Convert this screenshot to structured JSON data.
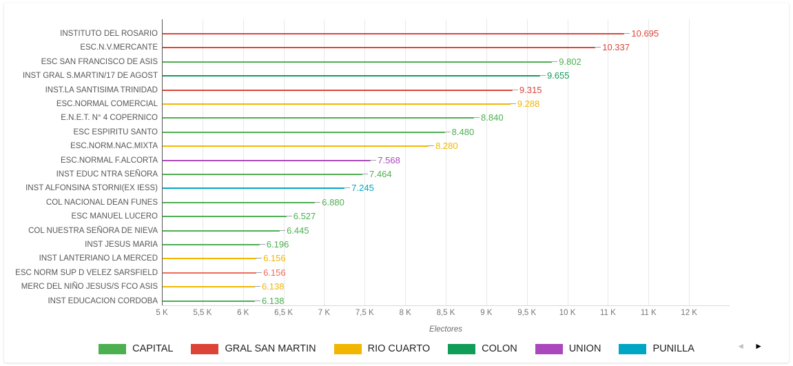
{
  "chart_data": {
    "type": "bar",
    "orientation": "horizontal",
    "title": "",
    "xlabel": "Electores",
    "ylabel": "",
    "xlim": [
      5000,
      12000
    ],
    "grid": true,
    "legend_position": "bottom",
    "x_tick_labels": [
      "5 K",
      "5,5 K",
      "6 K",
      "6,5 K",
      "7 K",
      "7,5 K",
      "8 K",
      "8,5 K",
      "9 K",
      "9,5 K",
      "10 K",
      "11 K",
      "11 K",
      "12 K"
    ],
    "x_tick_values": [
      5000,
      5500,
      6000,
      6500,
      7000,
      7500,
      8000,
      8500,
      9000,
      9500,
      10000,
      10500,
      11000,
      11500
    ],
    "categories": [
      "INSTITUTO DEL ROSARIO",
      "ESC.N.V.MERCANTE",
      "ESC SAN FRANCISCO DE ASIS",
      "INST GRAL S.MARTIN/17 DE AGOST",
      "INST.LA SANTISIMA TRINIDAD",
      "ESC.NORMAL COMERCIAL",
      "E.N.E.T. N° 4 COPERNICO",
      "ESC ESPIRITU SANTO",
      "ESC.NORM.NAC.MIXTA",
      "ESC.NORMAL F.ALCORTA",
      "INST EDUC NTRA SEÑORA",
      "INST ALFONSINA STORNI(EX IESS)",
      "COL NACIONAL DEAN FUNES",
      "ESC MANUEL LUCERO",
      "COL NUESTRA SEÑORA DE NIEVA",
      "INST JESUS MARIA",
      "INST LANTERIANO LA MERCED",
      "ESC NORM SUP D VELEZ SARSFIELD",
      "MERC DEL NIÑO JESUS/S FCO ASIS",
      "INST EDUCACION CORDOBA"
    ],
    "values": [
      10695,
      10337,
      9802,
      9655,
      9315,
      9288,
      8840,
      8480,
      8280,
      7568,
      7464,
      7245,
      6880,
      6527,
      6445,
      6196,
      6156,
      6156,
      6138,
      6138
    ],
    "value_labels": [
      "10.695",
      "10.337",
      "9.802",
      "9.655",
      "9.315",
      "9.288",
      "8.840",
      "8.480",
      "8.280",
      "7.568",
      "7.464",
      "7.245",
      "6.880",
      "6.527",
      "6.445",
      "6.196",
      "6.156",
      "6.156",
      "6.138",
      "6.138"
    ],
    "series_names": [
      "GRAL SAN MARTIN",
      "GRAL SAN MARTIN",
      "CAPITAL",
      "COLON",
      "GRAL SAN MARTIN",
      "RIO CUARTO",
      "CAPITAL",
      "CAPITAL",
      "RIO CUARTO",
      "UNION",
      "CAPITAL",
      "PUNILLA",
      "CAPITAL",
      "CAPITAL",
      "CAPITAL",
      "CAPITAL",
      "RIO CUARTO",
      "GRAL SAN MARTIN",
      "RIO CUARTO",
      "CAPITAL"
    ],
    "bar_colors": [
      "#DB4437",
      "#DB4437",
      "#4CAF50",
      "#0F9D58",
      "#DB4437",
      "#F2B600",
      "#4CAF50",
      "#4CAF50",
      "#F2B600",
      "#AB47BC",
      "#4CAF50",
      "#00A6C4",
      "#4CAF50",
      "#4CAF50",
      "#4CAF50",
      "#4CAF50",
      "#F2B600",
      "#EC6B5A",
      "#F2B600",
      "#4CAF50"
    ]
  },
  "legend": {
    "items": [
      {
        "label": "CAPITAL",
        "color": "#4CAF50"
      },
      {
        "label": "GRAL SAN MARTIN",
        "color": "#DB4437"
      },
      {
        "label": "RIO CUARTO",
        "color": "#F2B600"
      },
      {
        "label": "COLON",
        "color": "#0F9D58"
      },
      {
        "label": "UNION",
        "color": "#AB47BC"
      },
      {
        "label": "PUNILLA",
        "color": "#00A6C4"
      }
    ],
    "prev_arrow": "◄",
    "next_arrow": "►"
  }
}
